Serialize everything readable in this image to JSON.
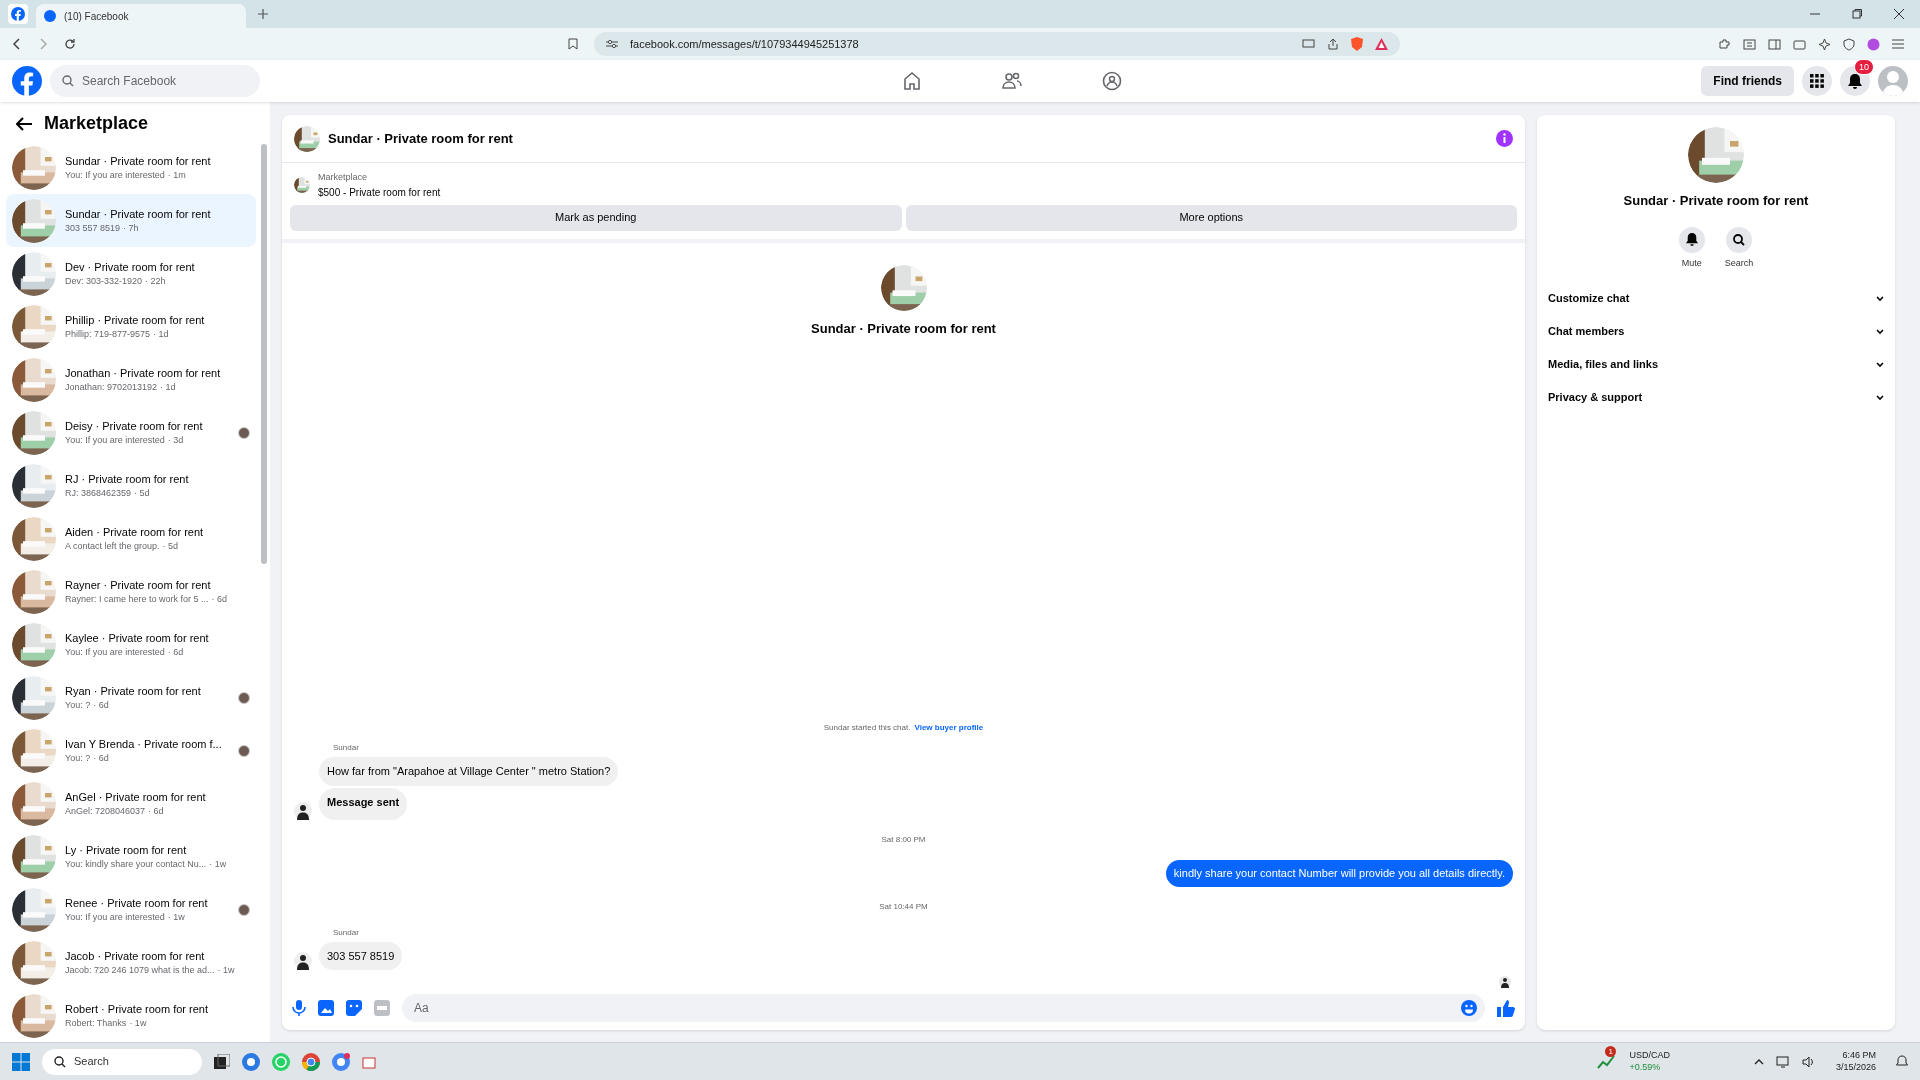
{
  "browser": {
    "tab_title": "(10) Facebook",
    "url": "facebook.com/messages/t/1079344945251378"
  },
  "header": {
    "search_placeholder": "Search Facebook",
    "find_friends": "Find friends",
    "notification_count": "10"
  },
  "sidebar": {
    "title": "Marketplace",
    "items": [
      {
        "name": "Sundar · Private room for rent",
        "preview": "You: If you are interested",
        "time": "· 1m",
        "selected": false,
        "read_receipt": false
      },
      {
        "name": "Sundar · Private room for rent",
        "preview": "303 557 8519",
        "time": "· 7h",
        "selected": true,
        "read_receipt": false
      },
      {
        "name": "Dev · Private room for rent",
        "preview": "Dev: 303-332-1920",
        "time": "· 22h",
        "selected": false,
        "read_receipt": false
      },
      {
        "name": "Phillip · Private room for rent",
        "preview": "Phillip: 719-877-9575",
        "time": "· 1d",
        "selected": false,
        "read_receipt": false
      },
      {
        "name": "Jonathan · Private room for rent",
        "preview": "Jonathan: 9702013192",
        "time": "· 1d",
        "selected": false,
        "read_receipt": false
      },
      {
        "name": "Deisy · Private room for rent",
        "preview": "You: If you are interested",
        "time": "· 3d",
        "selected": false,
        "read_receipt": true
      },
      {
        "name": "RJ · Private room for rent",
        "preview": "RJ: 3868462359",
        "time": "· 5d",
        "selected": false,
        "read_receipt": false
      },
      {
        "name": "Aiden · Private room for rent",
        "preview": "A contact left the group.",
        "time": "· 5d",
        "selected": false,
        "read_receipt": false
      },
      {
        "name": "Rayner · Private room for rent",
        "preview": "Rayner: I came here to work for 5 ...",
        "time": "· 6d",
        "selected": false,
        "read_receipt": false
      },
      {
        "name": "Kaylee · Private room for rent",
        "preview": "You: If you are interested",
        "time": "· 6d",
        "selected": false,
        "read_receipt": false
      },
      {
        "name": "Ryan · Private room for rent",
        "preview": "You: ?",
        "time": "· 6d",
        "selected": false,
        "read_receipt": true
      },
      {
        "name": "Ivan Y Brenda · Private room f...",
        "preview": "You: ?",
        "time": "· 6d",
        "selected": false,
        "read_receipt": true
      },
      {
        "name": "AnGel · Private room for rent",
        "preview": "AnGel: 7208046037",
        "time": "· 6d",
        "selected": false,
        "read_receipt": false
      },
      {
        "name": "Ly · Private room for rent",
        "preview": "You: kindly share your contact Nu...",
        "time": "· 1w",
        "selected": false,
        "read_receipt": false
      },
      {
        "name": "Renee · Private room for rent",
        "preview": "You: If you are interested",
        "time": "· 1w",
        "selected": false,
        "read_receipt": true
      },
      {
        "name": "Jacob · Private room for rent",
        "preview": "Jacob: 720 246 1079 what is the ad...",
        "time": "· 1w",
        "selected": false,
        "read_receipt": false
      },
      {
        "name": "Robert · Private room for rent",
        "preview": "Robert: Thanks",
        "time": "· 1w",
        "selected": false,
        "read_receipt": false
      }
    ]
  },
  "chat": {
    "title": "Sundar · Private room for rent",
    "listing_source": "Marketplace",
    "listing_title": "$500 - Private room for rent",
    "buttons": [
      "Mark as pending",
      "More options"
    ],
    "profile_name": "Sundar · Private room for rent",
    "messages": [
      {
        "kind": "notice",
        "text": "Sundar started this chat.",
        "link": "View buyer profile"
      },
      {
        "kind": "incoming",
        "sender": "Sundar",
        "bubbles": [
          {
            "text": "How far from \"Arapahoe at Village Center \" metro Station?",
            "bold": false
          },
          {
            "text": "Message sent",
            "bold": true
          }
        ]
      },
      {
        "kind": "time",
        "text": "Sat 8:00 PM"
      },
      {
        "kind": "outgoing",
        "bubbles": [
          {
            "text": "kindly share your contact Number will provide you all details directly.",
            "bold": false
          }
        ]
      },
      {
        "kind": "time",
        "text": "Sat 10:44 PM"
      },
      {
        "kind": "incoming",
        "sender": "Sundar",
        "bubbles": [
          {
            "text": "303 557 8519",
            "bold": false
          }
        ]
      }
    ],
    "composer_placeholder": "Aa"
  },
  "details": {
    "name": "Sundar · Private room for rent",
    "actions": [
      "Mute",
      "Search"
    ],
    "sections": [
      {
        "label": "Customize chat",
        "expanded": false
      },
      {
        "label": "Chat members",
        "expanded": false
      },
      {
        "label": "Media, files and links",
        "expanded": false
      },
      {
        "label": "Privacy & support",
        "expanded": false
      }
    ]
  },
  "taskbar": {
    "search": "Search",
    "ticker": "USD/CAD",
    "change": "+0.59%",
    "alert_count": "1",
    "time": "6:46 PM",
    "date": "3/15/2026"
  }
}
